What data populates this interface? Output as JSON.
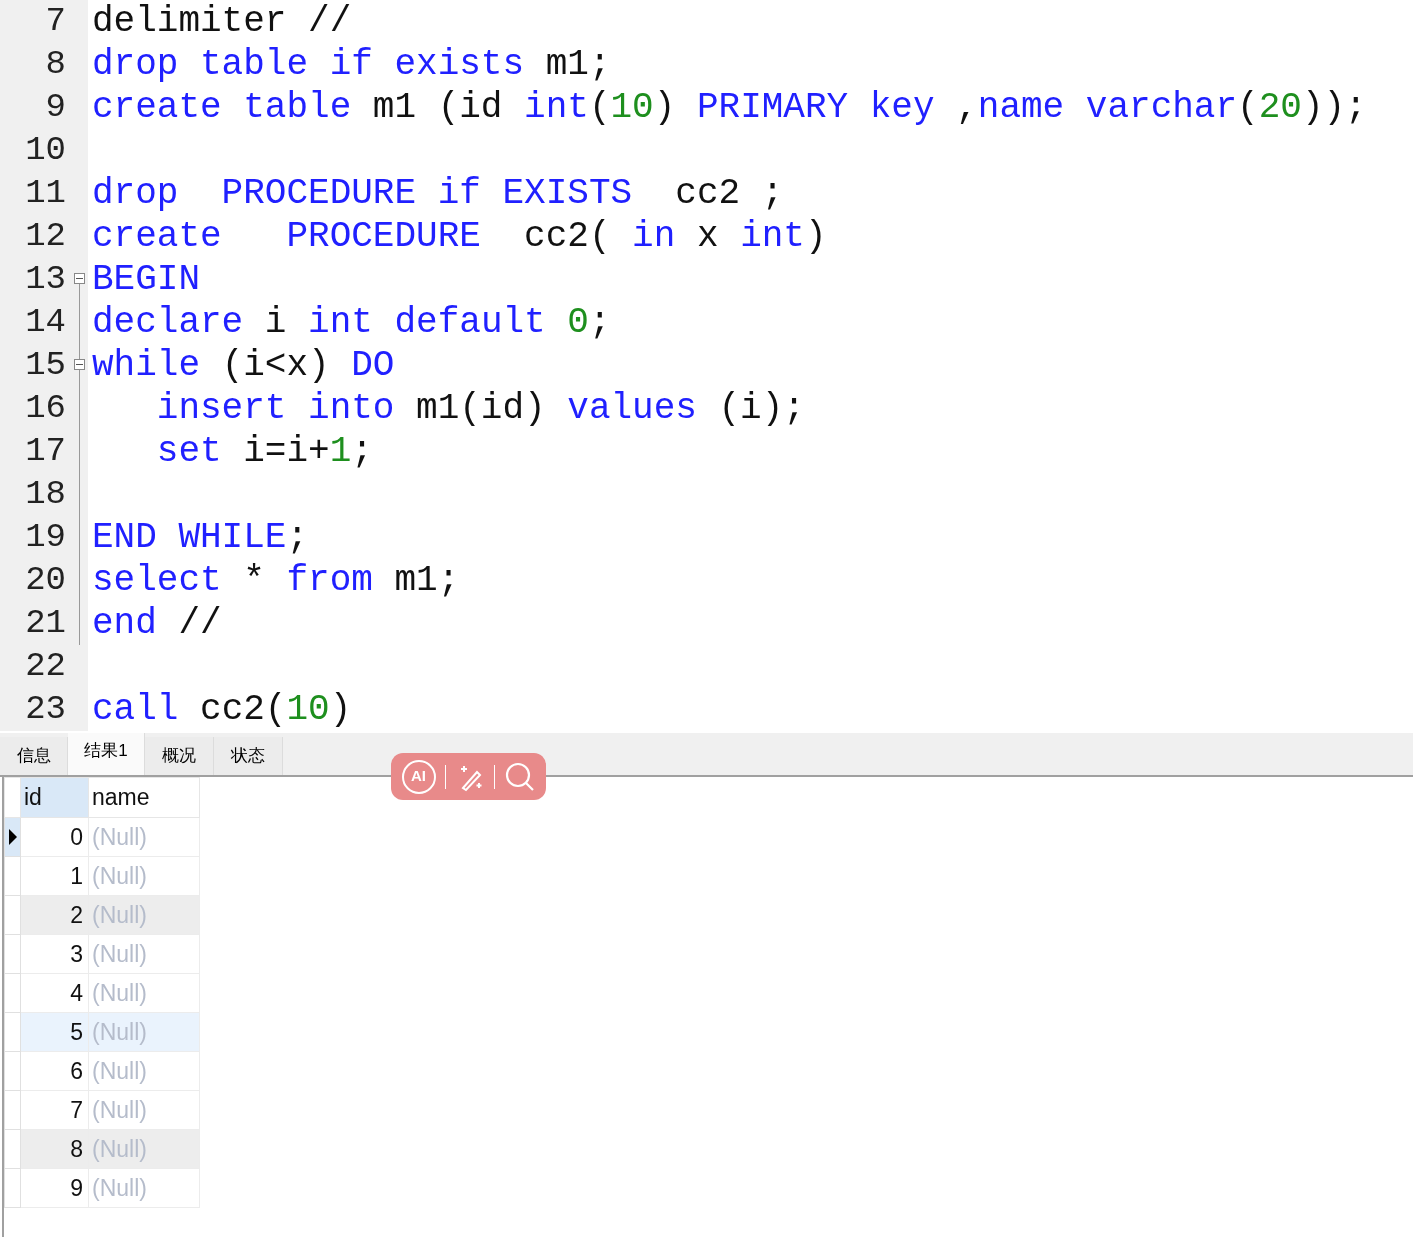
{
  "editor": {
    "lines": [
      {
        "number": "7",
        "collapsible": false,
        "in_block": false,
        "tokens": [
          {
            "kind": "plain",
            "text": "delimiter //"
          }
        ]
      },
      {
        "number": "8",
        "collapsible": false,
        "in_block": false,
        "tokens": [
          {
            "kind": "kw",
            "text": "drop table if exists"
          },
          {
            "kind": "plain",
            "text": " m1;"
          }
        ]
      },
      {
        "number": "9",
        "collapsible": false,
        "in_block": false,
        "tokens": [
          {
            "kind": "kw",
            "text": "create table"
          },
          {
            "kind": "plain",
            "text": " m1 (id "
          },
          {
            "kind": "kw",
            "text": "int"
          },
          {
            "kind": "plain",
            "text": "("
          },
          {
            "kind": "num",
            "text": "10"
          },
          {
            "kind": "plain",
            "text": ") "
          },
          {
            "kind": "kw",
            "text": "PRIMARY key"
          },
          {
            "kind": "plain",
            "text": " ,"
          },
          {
            "kind": "kw",
            "text": "name varchar"
          },
          {
            "kind": "plain",
            "text": "("
          },
          {
            "kind": "num",
            "text": "20"
          },
          {
            "kind": "plain",
            "text": "));"
          }
        ]
      },
      {
        "number": "10",
        "collapsible": false,
        "in_block": false
      },
      {
        "number": "11",
        "collapsible": false,
        "in_block": false,
        "tokens": [
          {
            "kind": "kw",
            "text": "drop  PROCEDURE if EXISTS"
          },
          {
            "kind": "plain",
            "text": "  cc2 ;"
          }
        ]
      },
      {
        "number": "12",
        "collapsible": false,
        "in_block": false,
        "tokens": [
          {
            "kind": "kw",
            "text": "create   PROCEDURE"
          },
          {
            "kind": "plain",
            "text": "  cc2( "
          },
          {
            "kind": "kw",
            "text": "in"
          },
          {
            "kind": "plain",
            "text": " x "
          },
          {
            "kind": "kw",
            "text": "int"
          },
          {
            "kind": "plain",
            "text": ")"
          }
        ]
      },
      {
        "number": "13",
        "collapsible": true,
        "in_block": false,
        "tokens": [
          {
            "kind": "kw",
            "text": "BEGIN"
          }
        ]
      },
      {
        "number": "14",
        "collapsible": false,
        "in_block": true,
        "tokens": [
          {
            "kind": "kw",
            "text": "declare"
          },
          {
            "kind": "plain",
            "text": " i "
          },
          {
            "kind": "kw",
            "text": "int default "
          },
          {
            "kind": "num",
            "text": "0"
          },
          {
            "kind": "plain",
            "text": ";"
          }
        ]
      },
      {
        "number": "15",
        "collapsible": true,
        "in_block": true,
        "tokens": [
          {
            "kind": "kw",
            "text": "while"
          },
          {
            "kind": "plain",
            "text": " (i<x) "
          },
          {
            "kind": "kw",
            "text": "DO"
          }
        ]
      },
      {
        "number": "16",
        "collapsible": false,
        "in_block": true,
        "tokens": [
          {
            "kind": "kw",
            "text": "   insert into"
          },
          {
            "kind": "plain",
            "text": " m1(id) "
          },
          {
            "kind": "kw",
            "text": "values"
          },
          {
            "kind": "plain",
            "text": " (i);"
          }
        ]
      },
      {
        "number": "17",
        "collapsible": false,
        "in_block": true,
        "tokens": [
          {
            "kind": "kw",
            "text": "   set"
          },
          {
            "kind": "plain",
            "text": " i=i+"
          },
          {
            "kind": "num",
            "text": "1"
          },
          {
            "kind": "plain",
            "text": ";"
          }
        ]
      },
      {
        "number": "18",
        "collapsible": false,
        "in_block": true
      },
      {
        "number": "19",
        "collapsible": false,
        "in_block": true,
        "tokens": [
          {
            "kind": "kw",
            "text": "END WHILE"
          },
          {
            "kind": "plain",
            "text": ";"
          }
        ]
      },
      {
        "number": "20",
        "collapsible": false,
        "in_block": true,
        "tokens": [
          {
            "kind": "kw",
            "text": "select"
          },
          {
            "kind": "plain",
            "text": " * "
          },
          {
            "kind": "kw",
            "text": "from"
          },
          {
            "kind": "plain",
            "text": " m1;"
          }
        ]
      },
      {
        "number": "21",
        "collapsible": false,
        "in_block": true,
        "tokens": [
          {
            "kind": "kw",
            "text": "end"
          },
          {
            "kind": "plain",
            "text": " //"
          }
        ]
      },
      {
        "number": "22",
        "collapsible": false,
        "in_block": false
      },
      {
        "number": "23",
        "collapsible": false,
        "in_block": false,
        "tokens": [
          {
            "kind": "kw",
            "text": "call"
          },
          {
            "kind": "plain",
            "text": " cc2("
          },
          {
            "kind": "num",
            "text": "10"
          },
          {
            "kind": "plain",
            "text": ")"
          }
        ]
      }
    ]
  },
  "tabs": [
    {
      "label": "信息",
      "selected": false
    },
    {
      "label": "结果1",
      "selected": true
    },
    {
      "label": "概况",
      "selected": false
    },
    {
      "label": "状态",
      "selected": false
    }
  ],
  "overlay_toolbar": {
    "ai_label": "AI"
  },
  "table": {
    "columns": [
      "id",
      "name"
    ],
    "rows": [
      {
        "id": "0",
        "name": "(Null)",
        "selected": true,
        "kind": "plain"
      },
      {
        "id": "1",
        "name": "(Null)",
        "selected": false,
        "kind": "plain"
      },
      {
        "id": "2",
        "name": "(Null)",
        "selected": false,
        "kind": "shaded"
      },
      {
        "id": "3",
        "name": "(Null)",
        "selected": false,
        "kind": "plain"
      },
      {
        "id": "4",
        "name": "(Null)",
        "selected": false,
        "kind": "plain"
      },
      {
        "id": "5",
        "name": "(Null)",
        "selected": false,
        "kind": "hover"
      },
      {
        "id": "6",
        "name": "(Null)",
        "selected": false,
        "kind": "plain"
      },
      {
        "id": "7",
        "name": "(Null)",
        "selected": false,
        "kind": "plain"
      },
      {
        "id": "8",
        "name": "(Null)",
        "selected": false,
        "kind": "shaded"
      },
      {
        "id": "9",
        "name": "(Null)",
        "selected": false,
        "kind": "plain"
      }
    ]
  }
}
